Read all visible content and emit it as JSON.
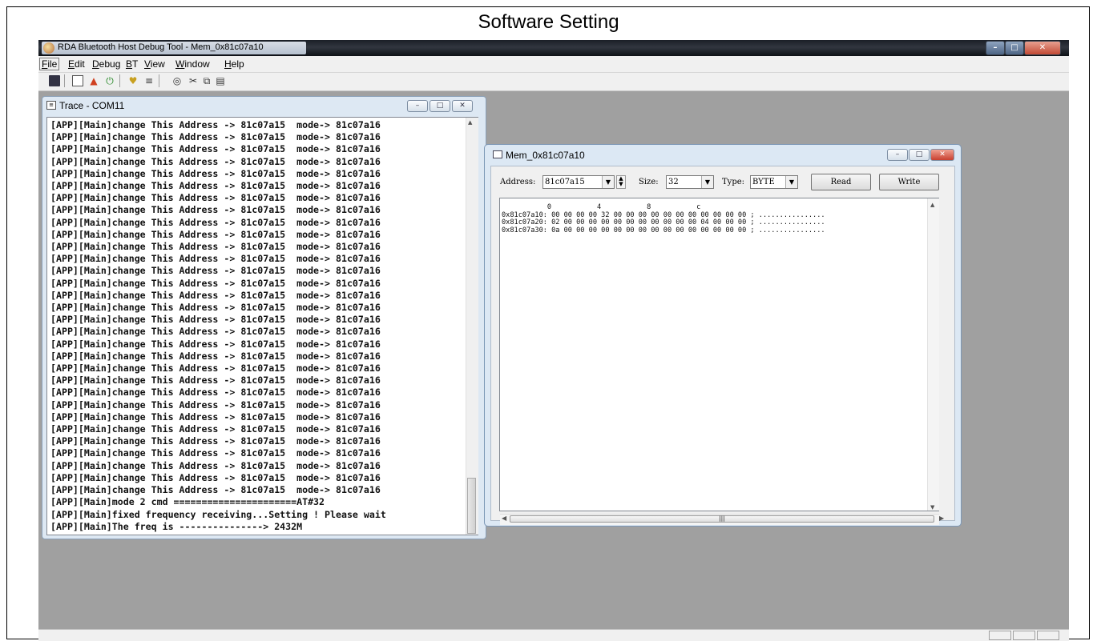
{
  "page": {
    "heading": "Software Setting"
  },
  "app": {
    "title": "RDA Bluetooth Host Debug Tool - Mem_0x81c07a10",
    "menu": [
      "File",
      "Edit",
      "Debug",
      "BT",
      "View",
      "Window",
      "Help"
    ],
    "toolbar_icons": [
      "save-icon",
      "window-icon",
      "color-icon",
      "power-icon",
      "heart-icon",
      "trace-icon",
      "binoculars-icon",
      "cut-icon",
      "copy-icon",
      "paste-icon"
    ]
  },
  "trace": {
    "title": "Trace - COM11",
    "lines": [
      "[APP][Main]change This Address -> 81c07a15  mode-> 81c07a16",
      "[APP][Main]change This Address -> 81c07a15  mode-> 81c07a16",
      "[APP][Main]change This Address -> 81c07a15  mode-> 81c07a16",
      "[APP][Main]change This Address -> 81c07a15  mode-> 81c07a16",
      "[APP][Main]change This Address -> 81c07a15  mode-> 81c07a16",
      "[APP][Main]change This Address -> 81c07a15  mode-> 81c07a16",
      "[APP][Main]change This Address -> 81c07a15  mode-> 81c07a16",
      "[APP][Main]change This Address -> 81c07a15  mode-> 81c07a16",
      "[APP][Main]change This Address -> 81c07a15  mode-> 81c07a16",
      "[APP][Main]change This Address -> 81c07a15  mode-> 81c07a16",
      "[APP][Main]change This Address -> 81c07a15  mode-> 81c07a16",
      "[APP][Main]change This Address -> 81c07a15  mode-> 81c07a16",
      "[APP][Main]change This Address -> 81c07a15  mode-> 81c07a16",
      "[APP][Main]change This Address -> 81c07a15  mode-> 81c07a16",
      "[APP][Main]change This Address -> 81c07a15  mode-> 81c07a16",
      "[APP][Main]change This Address -> 81c07a15  mode-> 81c07a16",
      "[APP][Main]change This Address -> 81c07a15  mode-> 81c07a16",
      "[APP][Main]change This Address -> 81c07a15  mode-> 81c07a16",
      "[APP][Main]change This Address -> 81c07a15  mode-> 81c07a16",
      "[APP][Main]change This Address -> 81c07a15  mode-> 81c07a16",
      "[APP][Main]change This Address -> 81c07a15  mode-> 81c07a16",
      "[APP][Main]change This Address -> 81c07a15  mode-> 81c07a16",
      "[APP][Main]change This Address -> 81c07a15  mode-> 81c07a16",
      "[APP][Main]change This Address -> 81c07a15  mode-> 81c07a16",
      "[APP][Main]change This Address -> 81c07a15  mode-> 81c07a16",
      "[APP][Main]change This Address -> 81c07a15  mode-> 81c07a16",
      "[APP][Main]change This Address -> 81c07a15  mode-> 81c07a16",
      "[APP][Main]change This Address -> 81c07a15  mode-> 81c07a16",
      "[APP][Main]change This Address -> 81c07a15  mode-> 81c07a16",
      "[APP][Main]change This Address -> 81c07a15  mode-> 81c07a16",
      "[APP][Main]change This Address -> 81c07a15  mode-> 81c07a16",
      "[APP][Main]mode 2 cmd ======================AT#32",
      "[APP][Main]fixed frequency receiving...Setting ! Please wait",
      "[APP][Main]The freq is ---------------> 2432M"
    ]
  },
  "mem": {
    "title": "Mem_0x81c07a10",
    "address_label": "Address:",
    "address_value": "81c07a15",
    "size_label": "Size:",
    "size_value": "32",
    "type_label": "Type:",
    "type_value": "BYTE",
    "read_label": "Read",
    "write_label": "Write",
    "hex_header": "           0           4           8           c",
    "hex_rows": [
      "0x81c07a10: 00 00 00 00 32 00 00 00 00 00 00 00 00 00 00 00 ; ................",
      "0x81c07a20: 02 00 00 00 00 00 00 00 00 00 00 00 04 00 00 00 ; ................",
      "0x81c07a30: 0a 00 00 00 00 00 00 00 00 00 00 00 00 00 00 00 ; ................"
    ]
  }
}
